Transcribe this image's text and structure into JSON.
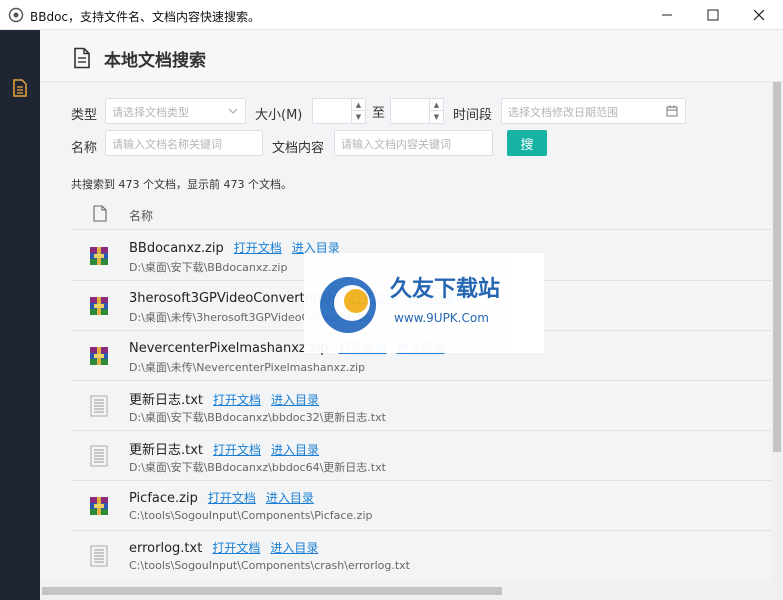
{
  "window": {
    "title": "BBdoc，支持文件名、文档内容快速搜索。",
    "minimize_glyph": "—",
    "maximize_glyph": "☐",
    "close_glyph": "✕"
  },
  "sidebar": {
    "items": [
      {
        "icon": "document-icon",
        "active": true
      }
    ]
  },
  "page": {
    "title": "本地文档搜索"
  },
  "form": {
    "type_label": "类型",
    "type_placeholder": "请选择文档类型",
    "size_label": "大小(M)",
    "size_to_label": "至",
    "time_label": "时间段",
    "time_placeholder": "选择文档修改日期范围",
    "name_label": "名称",
    "name_placeholder": "请输入文档名称关键词",
    "content_label": "文档内容",
    "content_placeholder": "请输入文档内容关键词",
    "search_button": "搜"
  },
  "results": {
    "summary": "共搜索到 473 个文档，显示前 473 个文档。",
    "column_name": "名称",
    "open_link": "打开文档",
    "dir_link": "进入目录",
    "rows": [
      {
        "icon": "winrar-icon",
        "name": "BBdocanxz.zip",
        "path": "D:\\桌面\\安下载\\BBdocanxz.zip"
      },
      {
        "icon": "winrar-icon",
        "name": "3herosoft3GPVideoConverter.zip",
        "path": "D:\\桌面\\未传\\3herosoft3GPVideoConverter.zip"
      },
      {
        "icon": "winrar-icon",
        "name": "NevercenterPixelmashanxz.zip",
        "path": "D:\\桌面\\未传\\NevercenterPixelmashanxz.zip"
      },
      {
        "icon": "text-file-icon",
        "name": "更新日志.txt",
        "path": "D:\\桌面\\安下载\\BBdocanxz\\bbdoc32\\更新日志.txt"
      },
      {
        "icon": "text-file-icon",
        "name": "更新日志.txt",
        "path": "D:\\桌面\\安下载\\BBdocanxz\\bbdoc64\\更新日志.txt"
      },
      {
        "icon": "winrar-icon",
        "name": "Picface.zip",
        "path": "C:\\tools\\SogouInput\\Components\\Picface.zip"
      },
      {
        "icon": "text-file-icon",
        "name": "errorlog.txt",
        "path": "C:\\tools\\SogouInput\\Components\\crash\\errorlog.txt"
      }
    ]
  },
  "watermark": {
    "name": "久友下载站",
    "url": "www.9UPK.Com"
  },
  "colors": {
    "sidebar": "#1f2532",
    "accent": "#17b3a3",
    "link": "#1a7fd4",
    "nav_icon": "#e8a33d"
  }
}
